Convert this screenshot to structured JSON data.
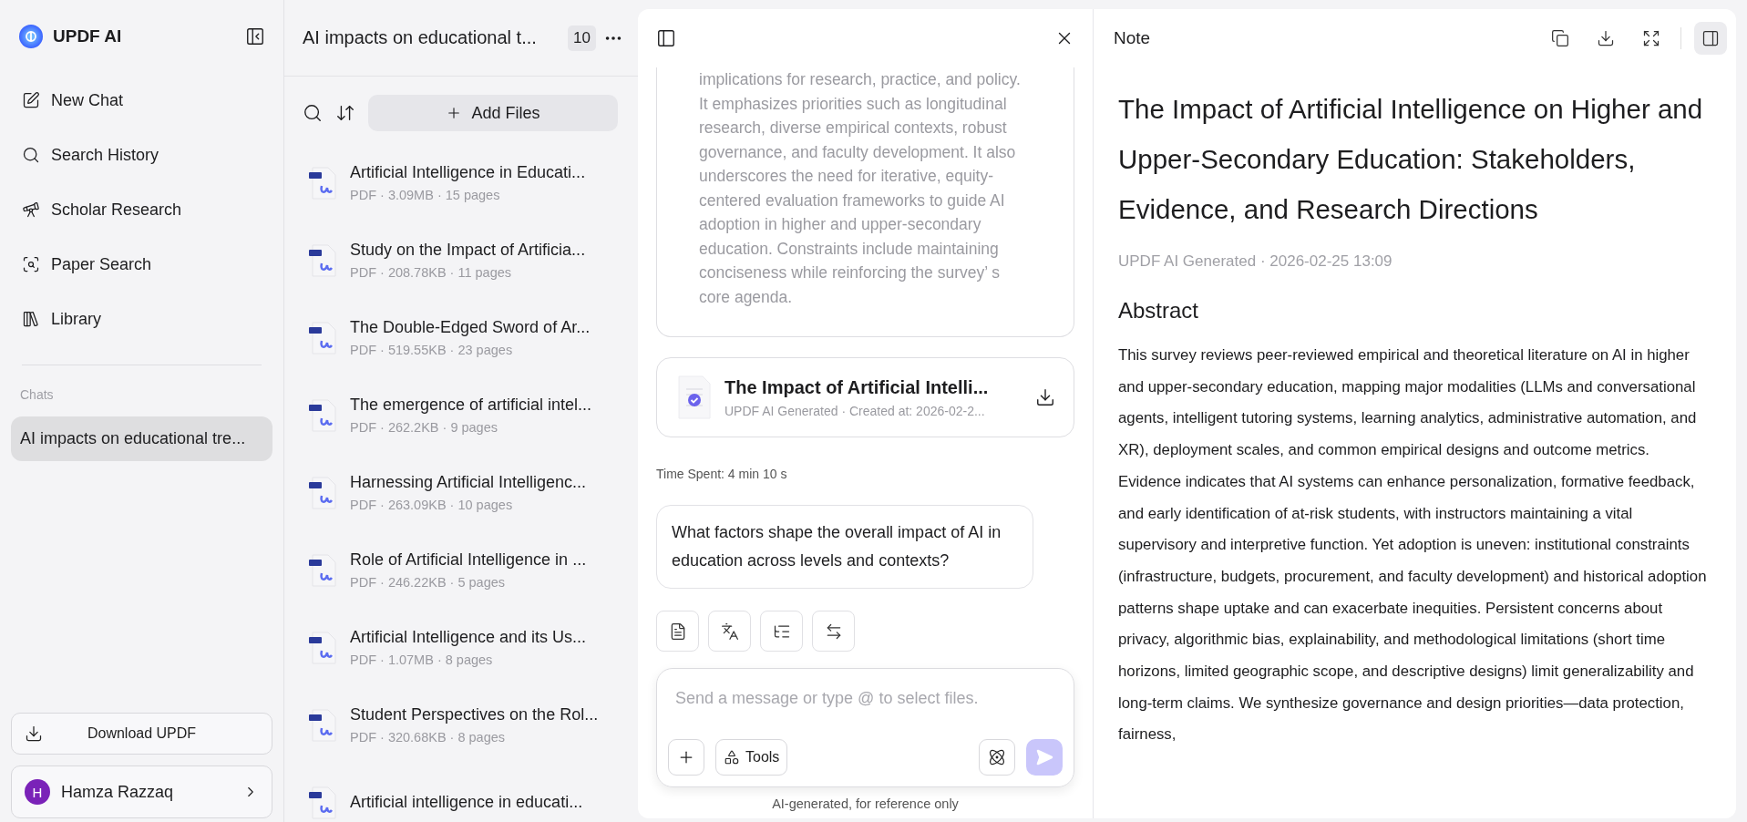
{
  "sidebar": {
    "brand": "UPDF AI",
    "items": [
      {
        "label": "New Chat"
      },
      {
        "label": "Search History"
      },
      {
        "label": "Scholar Research"
      },
      {
        "label": "Paper Search"
      },
      {
        "label": "Library"
      }
    ],
    "chats_heading": "Chats",
    "chats": [
      {
        "label": "AI impacts on educational tre...",
        "selected": true
      }
    ],
    "download_button": "Download UPDF",
    "user": {
      "initial": "H",
      "name": "Hamza Razzaq"
    }
  },
  "files_panel": {
    "title": "AI impacts on educational t...",
    "count": "10",
    "add_button": "Add Files",
    "files": [
      {
        "name": "Artificial Intelligence in Educati...",
        "meta": "PDF · 3.09MB · 15 pages"
      },
      {
        "name": "Study on the Impact of Artificia...",
        "meta": "PDF · 208.78KB · 11 pages"
      },
      {
        "name": "The Double-Edged Sword of Ar...",
        "meta": "PDF · 519.55KB · 23 pages"
      },
      {
        "name": "The emergence of artificial intel...",
        "meta": "PDF · 262.2KB · 9 pages"
      },
      {
        "name": "Harnessing Artificial Intelligenc...",
        "meta": "PDF · 263.09KB · 10 pages"
      },
      {
        "name": "Role of Artificial Intelligence in ...",
        "meta": "PDF · 246.22KB · 5 pages"
      },
      {
        "name": "Artificial Intelligence and its Us...",
        "meta": "PDF · 1.07MB · 8 pages"
      },
      {
        "name": "Student Perspectives on the Rol...",
        "meta": "PDF · 320.68KB · 8 pages"
      },
      {
        "name": "Artificial intelligence in educati..."
      }
    ]
  },
  "chat": {
    "answer_text": "implications for research, practice, and policy. It emphasizes priorities such as longitudinal research, diverse empirical contexts, robust governance, and faculty development. It also underscores the need for iterative, equity-centered evaluation frameworks to guide AI adoption in higher and upper-secondary education. Constraints include maintaining conciseness while reinforcing the survey’ s core agenda.",
    "document": {
      "title": "The Impact of Artificial Intelli...",
      "meta": "UPDF AI Generated · Created at: 2026-02-2..."
    },
    "time_spent": "Time Spent: 4 min 10 s",
    "question": "What factors shape the overall impact of AI in education across levels and contexts?",
    "input": {
      "placeholder": "Send a message or type @ to select files."
    },
    "tools_button": "Tools",
    "footer": "AI-generated, for reference only"
  },
  "note": {
    "title": "Note",
    "heading": "The Impact of Artificial Intelligence on Higher and Upper-Secondary Education: Stakeholders, Evidence, and Research Directions",
    "meta": "UPDF AI Generated · 2026-02-25 13:09",
    "section": "Abstract",
    "body": "This survey reviews peer-reviewed empirical and theoretical literature on AI in higher and upper-secondary education, mapping major modalities (LLMs and conversational agents, intelligent tutoring systems, learning analytics, administrative automation, and XR), deployment scales, and common empirical designs and outcome metrics. Evidence indicates that AI systems can enhance personalization, formative feedback, and early identification of at-risk students, with instructors maintaining a vital supervisory and interpretive function. Yet adoption is uneven: institutional constraints (infrastructure, budgets, procurement, and faculty development) and historical adoption patterns shape uptake and can exacerbate inequities. Persistent concerns about privacy, algorithmic bias, explainability, and methodological limitations (short time horizons, limited geographic scope, and descriptive designs) limit generalizability and long-term claims. We synthesize governance and design priorities—data protection, fairness,"
  }
}
